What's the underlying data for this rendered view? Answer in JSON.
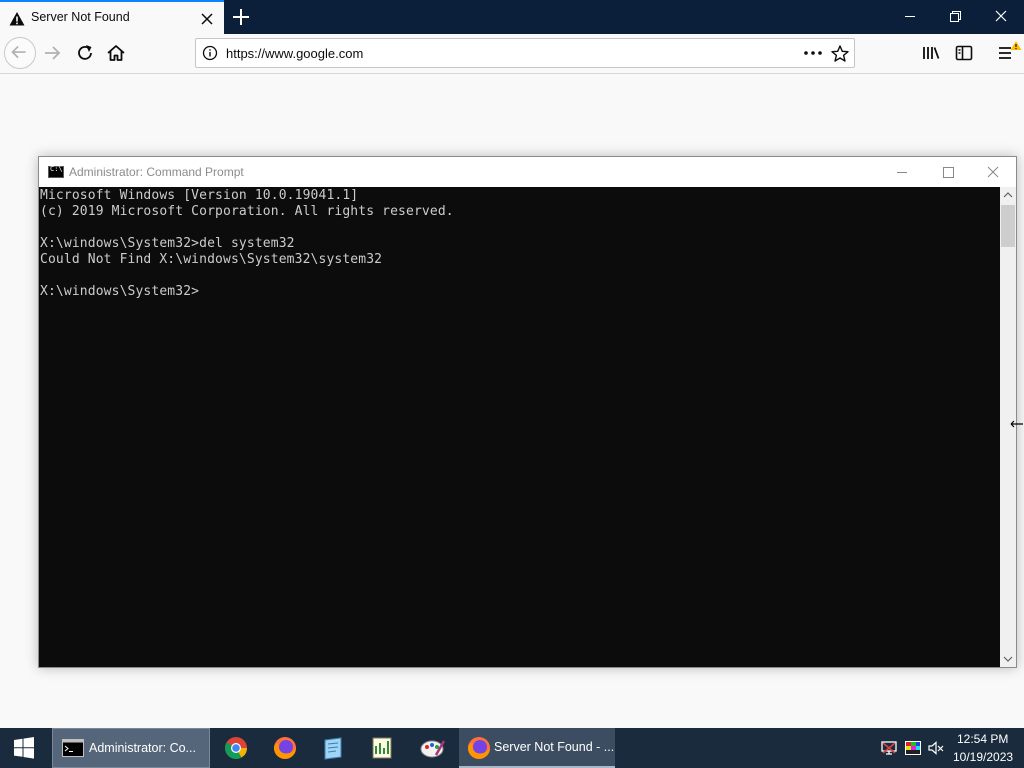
{
  "browser": {
    "tab": {
      "title": "Server Not Found",
      "icon": "warning-icon"
    },
    "new_tab_icon": "plus-icon",
    "url": "https://www.google.com",
    "window_controls": [
      "minimize-icon",
      "restore-icon",
      "close-icon"
    ],
    "toolbar_icons": [
      "back-icon",
      "forward-icon",
      "reload-icon",
      "home-icon",
      "page-info-icon",
      "page-actions-icon",
      "bookmark-star-icon",
      "library-icon",
      "sidebar-icon",
      "menu-icon"
    ],
    "colors": {
      "tabstrip": "#0b1f3a",
      "accent": "#0a84ff",
      "menu_badge": "#ffbf00"
    }
  },
  "console_window": {
    "title": "Administrator: Command Prompt",
    "lines": [
      "Microsoft Windows [Version 10.0.19041.1]",
      "(c) 2019 Microsoft Corporation. All rights reserved.",
      "",
      "X:\\windows\\System32>del system32",
      "Could Not Find X:\\windows\\System32\\system32",
      "",
      "X:\\windows\\System32>"
    ],
    "colors": {
      "background": "#0c0c0c",
      "text": "#cccccc"
    }
  },
  "taskbar": {
    "start_icon": "windows-logo-icon",
    "tasks": [
      {
        "label": "Administrator: Co...",
        "icon": "console-icon",
        "active": true
      },
      {
        "label": "Server Not Found - ...",
        "icon": "firefox-icon",
        "active": false
      }
    ],
    "pinned": [
      "chrome-icon",
      "firefox-icon",
      "notepad-icon",
      "regedit-icon",
      "paint-icon"
    ],
    "tray": [
      "network-icon",
      "color-palette-icon",
      "volume-muted-icon"
    ],
    "clock": {
      "time": "12:54 PM",
      "date": "10/19/2023"
    },
    "colors": {
      "background": "#1b2b3e"
    }
  }
}
